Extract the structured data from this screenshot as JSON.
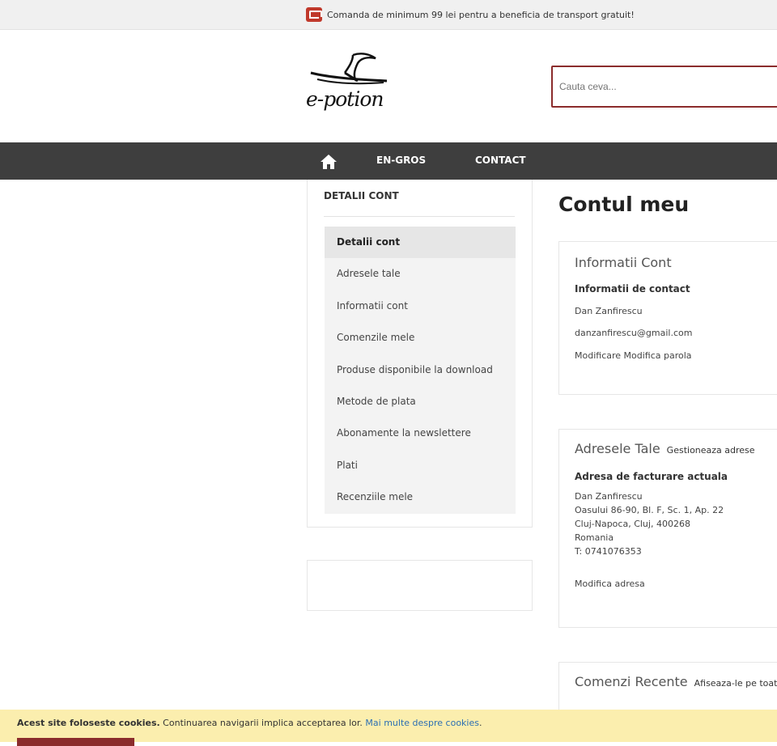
{
  "topbar": {
    "icon": "truck-icon",
    "message": "Comanda de minimum 99 lei pentru a beneficia de transport gratuit!"
  },
  "header": {
    "logo_text": "e-potion",
    "search_placeholder": "Cauta ceva..."
  },
  "nav": {
    "items": [
      {
        "label": "EN-GROS"
      },
      {
        "label": "CONTACT"
      }
    ],
    "home_icon": "home-icon"
  },
  "sidebar": {
    "title": "DETALII CONT",
    "items": [
      {
        "label": "Detalii cont",
        "active": true
      },
      {
        "label": "Adresele tale"
      },
      {
        "label": "Informatii cont"
      },
      {
        "label": "Comenzile mele"
      },
      {
        "label": "Produse disponibile la download"
      },
      {
        "label": "Metode de plata"
      },
      {
        "label": "Abonamente la newslettere"
      },
      {
        "label": "Plati"
      },
      {
        "label": "Recenziile mele"
      }
    ]
  },
  "main": {
    "title": "Contul meu",
    "account_box": {
      "title": "Informatii Cont",
      "subtitle": "Informatii de contact",
      "name": "Dan Zanfirescu",
      "email": "danzanfirescu@gmail.com",
      "edit_label": "Modificare",
      "change_password_label": "Modifica parola"
    },
    "address_box": {
      "title": "Adresele Tale",
      "manage_label": "Gestioneaza adrese",
      "subtitle": "Adresa de facturare actuala",
      "lines": [
        "Dan Zanfirescu",
        "Oasului 86-90, Bl. F, Sc. 1, Ap. 22",
        "Cluj-Napoca, Cluj, 400268",
        "Romania",
        "T: 0741076353"
      ],
      "edit_label": "Modifica adresa"
    },
    "orders_box": {
      "title": "Comenzi Recente",
      "view_all_label": "Afiseaza-le pe toate"
    }
  },
  "cookie": {
    "bold_text": "Acest site foloseste cookies.",
    "text": " Continuarea navigarii implica acceptarea lor. ",
    "link": "Mai multe despre cookies",
    "after": "."
  },
  "colors": {
    "accent": "#8b2c2c",
    "nav_bg": "#3e3e3e",
    "cookie_bg": "#fbeeae",
    "link": "#2c6fb3"
  }
}
